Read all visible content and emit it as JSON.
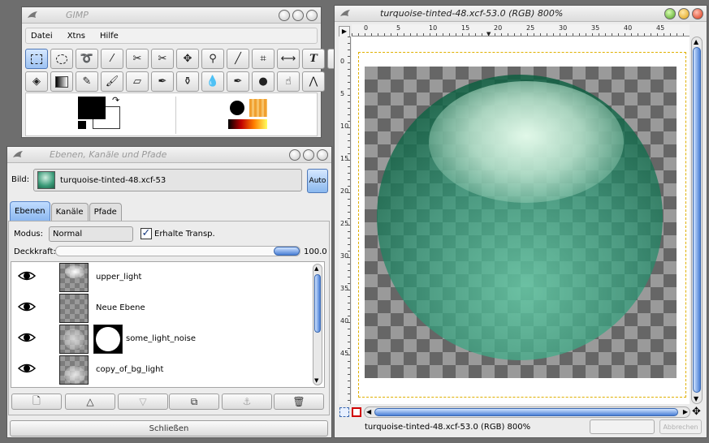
{
  "toolbox": {
    "title": "GIMP",
    "menu": [
      "Datei",
      "Xtns",
      "Hilfe"
    ],
    "tools_row1": [
      "rect-select",
      "ellipse-select",
      "lasso",
      "fuzzy-select",
      "color-select",
      "paths",
      "move",
      "zoom",
      "measure",
      "crop",
      "flip",
      "text",
      "color-picker"
    ],
    "tools_row2": [
      "bucket-fill",
      "blend",
      "pencil",
      "paintbrush",
      "eraser",
      "airbrush",
      "clone",
      "smudge",
      "ink",
      "dodge-burn",
      "convolve",
      "transform"
    ],
    "colors": {
      "fg": "#000000",
      "bg": "#ffffff"
    }
  },
  "layers_dialog": {
    "title": "Ebenen, Kanäle und Pfade",
    "image_label": "Bild:",
    "image_name": "turquoise-tinted-48.xcf-53",
    "auto_label": "Auto",
    "tabs": [
      "Ebenen",
      "Kanäle",
      "Pfade"
    ],
    "mode_label": "Modus:",
    "mode_value": "Normal",
    "keep_trans_label": "Erhalte Transp.",
    "keep_trans_checked": true,
    "opacity_label": "Deckkraft:",
    "opacity_value": "100.0",
    "layers": [
      {
        "name": "upper_light",
        "mask": false
      },
      {
        "name": "Neue Ebene",
        "mask": false
      },
      {
        "name": "some_light_noise",
        "mask": true
      },
      {
        "name": "copy_of_bg_light",
        "mask": false
      }
    ],
    "close_label": "Schließen"
  },
  "image_window": {
    "title": "turquoise-tinted-48.xcf-53.0 (RGB) 800%",
    "status": "turquoise-tinted-48.xcf-53.0 (RGB) 800%",
    "cancel_label": "Abbrechen",
    "hruler": [
      "0",
      "5",
      "10",
      "15",
      "20",
      "25",
      "30",
      "35",
      "40",
      "45"
    ],
    "vruler": [
      "0",
      "5",
      "10",
      "15",
      "20",
      "25",
      "30",
      "35",
      "40",
      "45"
    ]
  }
}
